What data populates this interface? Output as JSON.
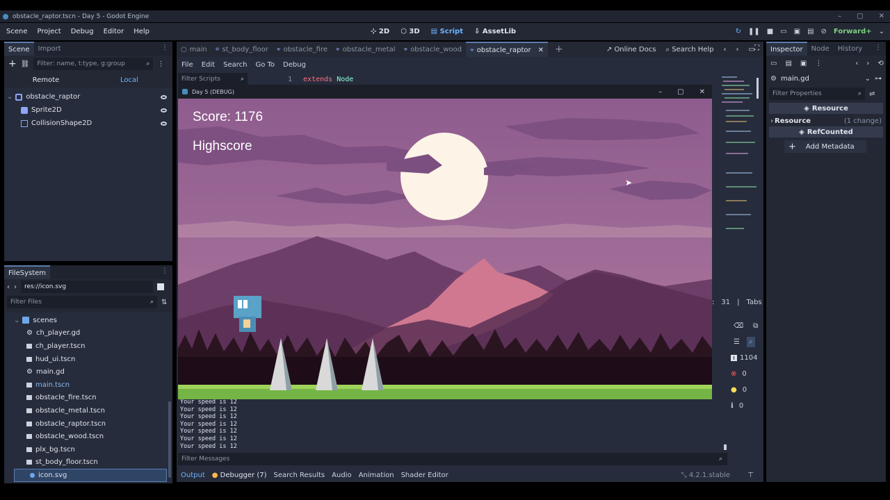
{
  "window": {
    "title": "obstacle_raptor.tscn - Day 5 - Godot Engine"
  },
  "menu": [
    "Scene",
    "Project",
    "Debug",
    "Editor",
    "Help"
  ],
  "workspaces": [
    {
      "label": "2D",
      "icon": "2d-icon"
    },
    {
      "label": "3D",
      "icon": "3d-icon"
    },
    {
      "label": "Script",
      "icon": "script-icon"
    },
    {
      "label": "AssetLib",
      "icon": "assetlib-icon"
    }
  ],
  "renderer": "Forward+",
  "scene_dock": {
    "tabs": [
      "Scene",
      "Import"
    ],
    "filter_placeholder": "Filter: name, t:type, g:group",
    "remote": "Remote",
    "local": "Local",
    "nodes": [
      "obstacle_raptor",
      "Sprite2D",
      "CollisionShape2D"
    ]
  },
  "filesystem": {
    "title": "FileSystem",
    "path": "res://icon.svg",
    "filter_placeholder": "Filter Files",
    "folder": "scenes",
    "files": [
      "ch_player.gd",
      "ch_player.tscn",
      "hud_ui.tscn",
      "main.gd",
      "main.tscn",
      "obstacle_fire.tscn",
      "obstacle_metal.tscn",
      "obstacle_raptor.tscn",
      "obstacle_wood.tscn",
      "plx_bg.tscn",
      "st_body_floor.tscn"
    ],
    "selected": "icon.svg"
  },
  "editor_tabs": [
    "main",
    "st_body_floor",
    "obstacle_fire",
    "obstacle_metal",
    "obstacle_wood",
    "obstacle_raptor"
  ],
  "script_menu": [
    "File",
    "Edit",
    "Search",
    "Go To",
    "Debug"
  ],
  "online_docs": "Online Docs",
  "search_help": "Search Help",
  "filter_scripts": "Filter Scripts",
  "code": {
    "line": "1",
    "keyword": "extends",
    "type": "Node"
  },
  "cursor_info": {
    "col": ":",
    "num": "31",
    "indent": "Tabs"
  },
  "game_window": {
    "title": "Day 5 (DEBUG)",
    "score": "Score: 1176",
    "highscore": "Highscore"
  },
  "output_lines": [
    "Your speed is 12",
    "Your speed is 12",
    "Your speed is 12",
    "Your speed is 12",
    "Your speed is 12",
    "Your speed is 12",
    "Your speed is 12"
  ],
  "filter_messages": "Filter Messages",
  "bottom_tabs": [
    "Output",
    "Debugger (7)",
    "Search Results",
    "Audio",
    "Animation",
    "Shader Editor"
  ],
  "version": "4.2.1.stable",
  "counters": [
    "1104",
    "0",
    "0",
    "0"
  ],
  "inspector": {
    "tabs": [
      "Inspector",
      "Node",
      "History"
    ],
    "resource_name": "main.gd",
    "filter_placeholder": "Filter Properties",
    "section_resource": "Resource",
    "subsection": "Resource",
    "change": "(1 change)",
    "refcounted": "RefCounted",
    "add_metadata": "Add Metadata"
  }
}
